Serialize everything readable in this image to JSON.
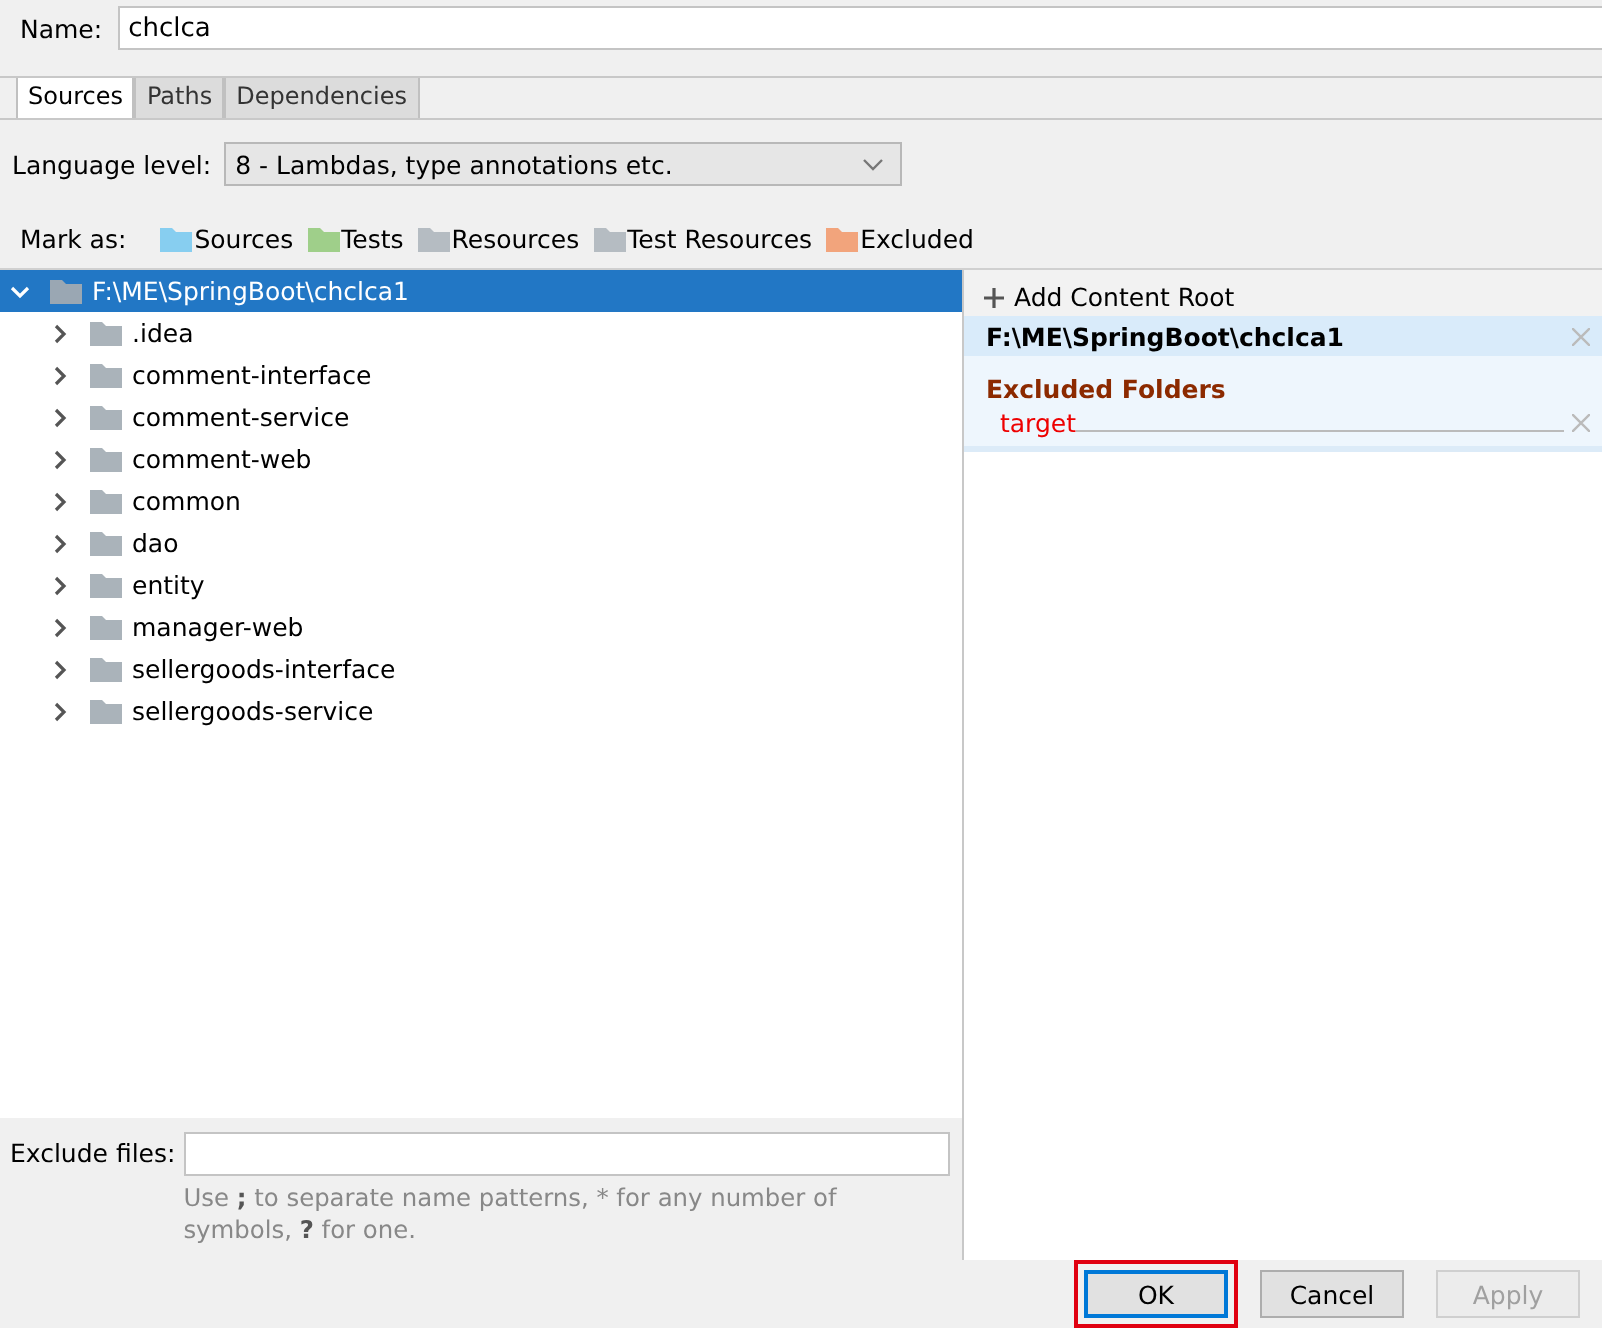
{
  "name_field": {
    "label": "Name:",
    "value": "chclca"
  },
  "tabs": [
    {
      "label": "Sources",
      "selected": true
    },
    {
      "label": "Paths",
      "selected": false
    },
    {
      "label": "Dependencies",
      "selected": false
    }
  ],
  "language_level": {
    "label": "Language level:",
    "value": "8 - Lambdas, type annotations etc."
  },
  "mark_as": {
    "label": "Mark as:",
    "items": [
      {
        "label": "Sources",
        "color": "#87cef0"
      },
      {
        "label": "Tests",
        "color": "#9fcf8a"
      },
      {
        "label": "Resources",
        "color": "#b5bcc2"
      },
      {
        "label": "Test Resources",
        "color": "#b5bcc2"
      },
      {
        "label": "Excluded",
        "color": "#f2a47c"
      }
    ]
  },
  "tree": [
    {
      "label": "F:\\ME\\SpringBoot\\chclca1",
      "expanded": true,
      "selected": true,
      "children": [
        {
          "label": ".idea",
          "expanded": false,
          "selected": false
        },
        {
          "label": "comment-interface",
          "expanded": false,
          "selected": false
        },
        {
          "label": "comment-service",
          "expanded": false,
          "selected": false
        },
        {
          "label": "comment-web",
          "expanded": false,
          "selected": false
        },
        {
          "label": "common",
          "expanded": false,
          "selected": false
        },
        {
          "label": "dao",
          "expanded": false,
          "selected": false
        },
        {
          "label": "entity",
          "expanded": false,
          "selected": false
        },
        {
          "label": "manager-web",
          "expanded": false,
          "selected": false
        },
        {
          "label": "sellergoods-interface",
          "expanded": false,
          "selected": false
        },
        {
          "label": "sellergoods-service",
          "expanded": false,
          "selected": false
        }
      ]
    }
  ],
  "exclude_files": {
    "label": "Exclude files:",
    "hint": "Use **;** to separate name patterns, * for any number of symbols, **?** for one."
  },
  "content_root": {
    "add_label": "Add Content Root",
    "path": "F:\\ME\\SpringBoot\\chclca1",
    "section_title": "Excluded Folders",
    "folders": [
      "target"
    ]
  },
  "buttons": [
    {
      "label": "OK",
      "disabled": false,
      "highlighted": true
    },
    {
      "label": "Cancel",
      "disabled": false,
      "highlighted": false
    },
    {
      "label": "Apply",
      "disabled": true,
      "highlighted": false
    }
  ]
}
